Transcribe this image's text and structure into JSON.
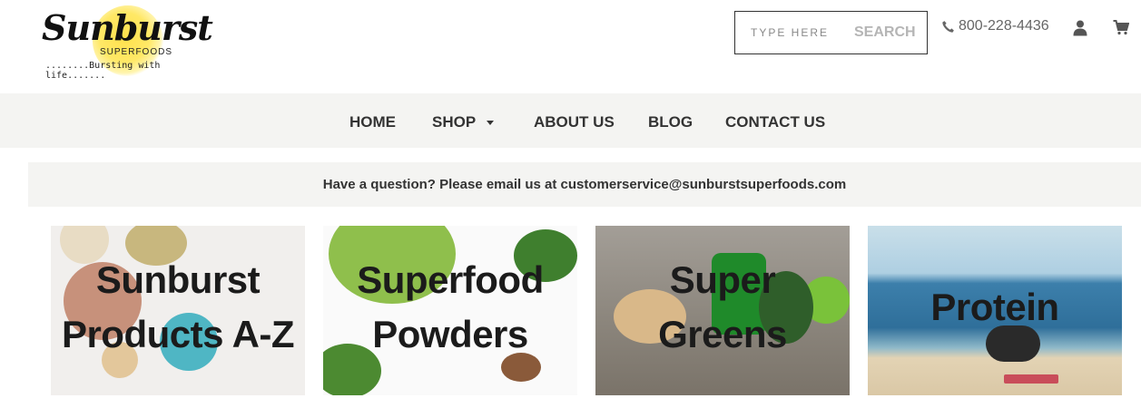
{
  "logo": {
    "brand": "Sunburst",
    "subtitle": "SUPERFOODS",
    "tagline": "........Bursting with life......."
  },
  "search": {
    "placeholder": "TYPE HERE",
    "button": "SEARCH"
  },
  "contact": {
    "phone": "800-228-4436"
  },
  "icons": {
    "phone": "phone-icon",
    "user": "user-icon",
    "cart": "cart-icon"
  },
  "nav": {
    "items": [
      {
        "label": "HOME"
      },
      {
        "label": "SHOP"
      },
      {
        "label": "ABOUT US"
      },
      {
        "label": "BLOG"
      },
      {
        "label": "CONTACT US"
      }
    ]
  },
  "notice": "Have a question? Please email us at customerservice@sunburstsuperfoods.com",
  "categories": [
    {
      "line1": "Sunburst",
      "line2": "Products A-Z"
    },
    {
      "line1": "Superfood",
      "line2": "Powders"
    },
    {
      "line1": "Super",
      "line2": "Greens"
    },
    {
      "line1": "Protein",
      "line2": ""
    }
  ],
  "colors": {
    "nav_bg": "#f4f4f2",
    "text": "#333333",
    "logo_accent": "#ffe14d"
  }
}
